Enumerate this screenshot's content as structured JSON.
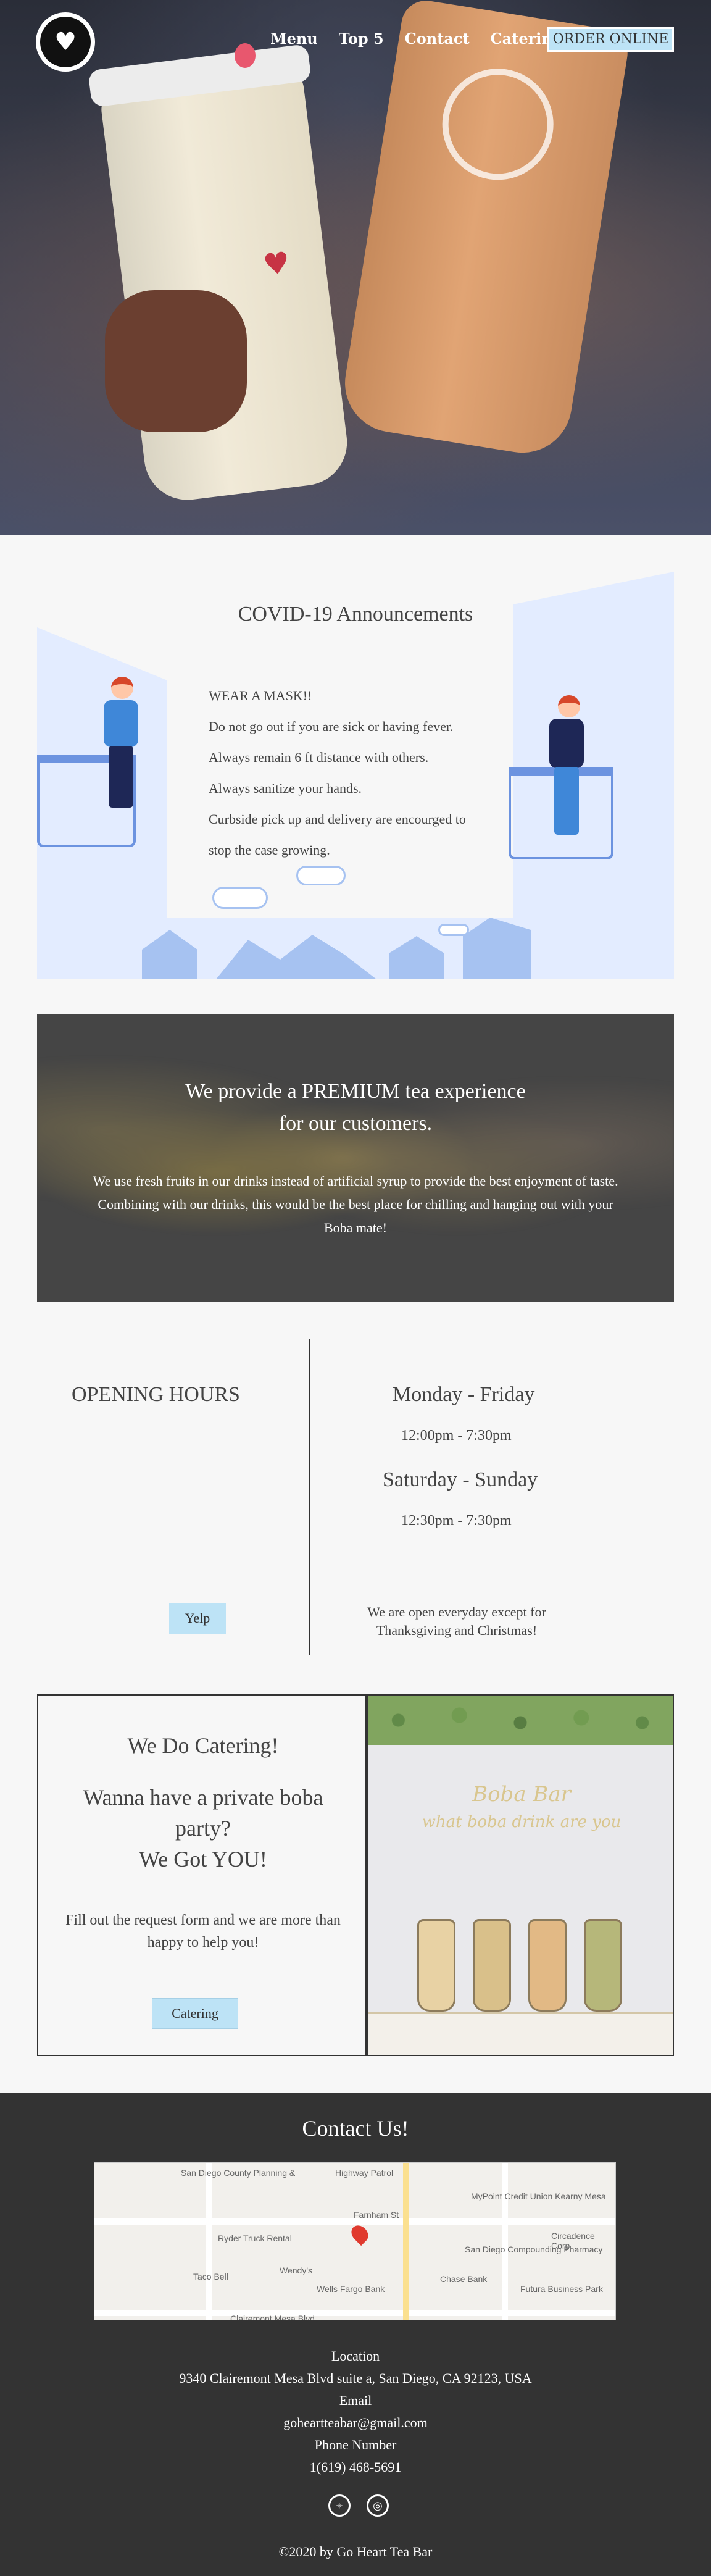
{
  "nav": {
    "items": [
      "Menu",
      "Top 5",
      "Contact",
      "Catering"
    ],
    "order_label": "ORDER ONLINE"
  },
  "covid": {
    "title": "COVID-19 Announcements",
    "lines": [
      "WEAR A MASK!!",
      "Do not go out if you are sick or   having fever.",
      "Always remain 6 ft distance with others.",
      "Always sanitize your hands.",
      "Curbside pick up and delivery are encourged to",
      "stop the case growing."
    ]
  },
  "premium": {
    "heading_line1": "We provide a PREMIUM tea experience",
    "heading_line2": "for our customers.",
    "description": "We use fresh fruits in our drinks instead of artificial syrup to provide the best enjoyment of taste. Combining with our drinks, this would be the best place for chilling and hanging out with your Boba mate!"
  },
  "hours": {
    "label": "OPENING HOURS",
    "weekday_label": "Monday - Friday",
    "weekday_time": "12:00pm - 7:30pm",
    "weekend_label": "Saturday - Sunday",
    "weekend_time": "12:30pm - 7:30pm",
    "yelp_label": "Yelp",
    "note": "We are open everyday except for Thanksgiving and Christmas!"
  },
  "catering": {
    "title": "We Do Catering!",
    "subtitle_line1": "Wanna have a private boba",
    "subtitle_line2": "party?",
    "subtitle_line3": "We Got YOU!",
    "body": "Fill out the request form and we are more than happy to help you!",
    "button_label": "Catering",
    "photo_text1": "Boba Bar",
    "photo_text2": "what boba drink are you"
  },
  "contact": {
    "title": "Contact Us!",
    "location_label": "Location",
    "address": "9340 Clairemont Mesa Blvd suite a, San Diego, CA 92123, USA",
    "email_label": "Email",
    "email": "goheartteabar@gmail.com",
    "phone_label": "Phone Number",
    "phone": "1(619) 468-5691",
    "copyright": "©2020 by Go Heart Tea Bar",
    "map_labels": [
      "San Diego County Planning &",
      "Highway Patrol",
      "MyPoint Credit Union Kearny Mesa",
      "Ryder Truck Rental",
      "Taco Bell",
      "Wendy's",
      "Wells Fargo Bank",
      "San Diego Compounding Pharmacy",
      "Chase Bank",
      "Futura Business Park",
      "Circadence Corp",
      "Clairemont Mesa Blvd",
      "Farnham St"
    ]
  },
  "icons": [
    "logo-heart-icon",
    "location-pin-icon",
    "instagram-icon"
  ]
}
